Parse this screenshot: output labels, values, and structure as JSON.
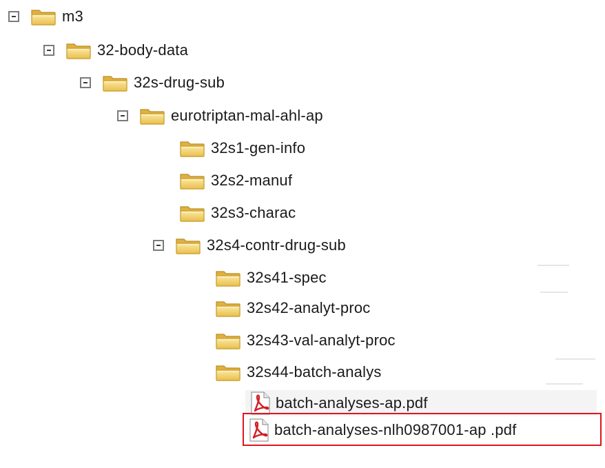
{
  "tree": {
    "nodes": [
      {
        "label": "m3",
        "type": "folder",
        "expanded": true,
        "depth": 0
      },
      {
        "label": "32-body-data",
        "type": "folder",
        "expanded": true,
        "depth": 1
      },
      {
        "label": "32s-drug-sub",
        "type": "folder",
        "expanded": true,
        "depth": 2
      },
      {
        "label": "eurotriptan-mal-ahl-ap",
        "type": "folder",
        "expanded": true,
        "depth": 3
      },
      {
        "label": "32s1-gen-info",
        "type": "folder",
        "depth": 4
      },
      {
        "label": "32s2-manuf",
        "type": "folder",
        "depth": 4
      },
      {
        "label": "32s3-charac",
        "type": "folder",
        "depth": 4
      },
      {
        "label": "32s4-contr-drug-sub",
        "type": "folder",
        "expanded": true,
        "depth": 4
      },
      {
        "label": "32s41-spec",
        "type": "folder",
        "depth": 5
      },
      {
        "label": "32s42-analyt-proc",
        "type": "folder",
        "depth": 5
      },
      {
        "label": "32s43-val-analyt-proc",
        "type": "folder",
        "depth": 5
      },
      {
        "label": "32s44-batch-analys",
        "type": "folder",
        "depth": 5
      },
      {
        "label": "batch-analyses-ap.pdf",
        "type": "pdf",
        "depth": 6
      },
      {
        "label": "batch-analyses-nlh0987001-ap .pdf",
        "type": "pdf",
        "depth": 6,
        "highlighted": true
      }
    ]
  },
  "colors": {
    "highlight_border": "#e1141c",
    "folder_fill": "#f5d77a",
    "folder_edge": "#c9a030",
    "pdf_red": "#d21f26"
  },
  "icons": {
    "folder": "folder-icon",
    "pdf": "pdf-file-icon",
    "collapse": "collapse-toggle-icon"
  }
}
